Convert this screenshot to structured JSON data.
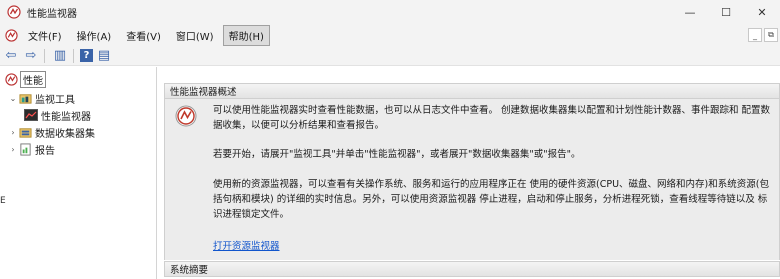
{
  "window": {
    "title": "性能监视器",
    "minimize": "—",
    "maximize": "☐",
    "close": "✕"
  },
  "menu": {
    "items": [
      "文件(F)",
      "操作(A)",
      "查看(V)",
      "窗口(W)",
      "帮助(H)"
    ],
    "active_index": 4
  },
  "mdi": {
    "minimize": "_",
    "restore": "⧉"
  },
  "toolbar": {
    "back": "⇦",
    "forward": "⇨",
    "show_hide_tree": "▥",
    "help": "?",
    "properties": "▤"
  },
  "tree": {
    "root": "性能",
    "items": [
      {
        "label": "监视工具",
        "expanded": true,
        "level": 1
      },
      {
        "label": "性能监视器",
        "level": 2
      },
      {
        "label": "数据收集器集",
        "expanded": false,
        "level": 1
      },
      {
        "label": "报告",
        "expanded": false,
        "level": 1
      }
    ]
  },
  "overview": {
    "heading": "性能监视器概述",
    "paragraph1": "可以使用性能监视器实时查看性能数据，也可以从日志文件中查看。 创建数据收集器集以配置和计划性能计数器、事件跟踪和 配置数据收集，以便可以分析结果和查看报告。",
    "paragraph2": "若要开始，请展开\"监视工具\"并单击\"性能监视器\"，或者展开\"数据收集器集\"或\"报告\"。",
    "paragraph3": "使用新的资源监视器，可以查看有关操作系统、服务和运行的应用程序正在 使用的硬件资源(CPU、磁盘、网络和内存)和系统资源(包括句柄和模块) 的详细的实时信息。另外，可以使用资源监视器 停止进程，启动和停止服务，分析进程死锁，查看线程等待链以及 标识进程锁定文件。",
    "link": "打开资源监视器"
  },
  "summary": {
    "heading": "系统摘要"
  },
  "icons": {
    "app": "perfmon-gauge-icon",
    "tree_root": "perfmon-gauge-icon",
    "monitoring_tools": "folder-tools-icon",
    "performance_monitor": "chart-icon",
    "data_collector_sets": "collector-icon",
    "reports": "report-icon"
  },
  "colors": {
    "accent_link": "#1155cc",
    "section_bg": "#ececec",
    "chrome_bg": "#f3f3f3"
  }
}
